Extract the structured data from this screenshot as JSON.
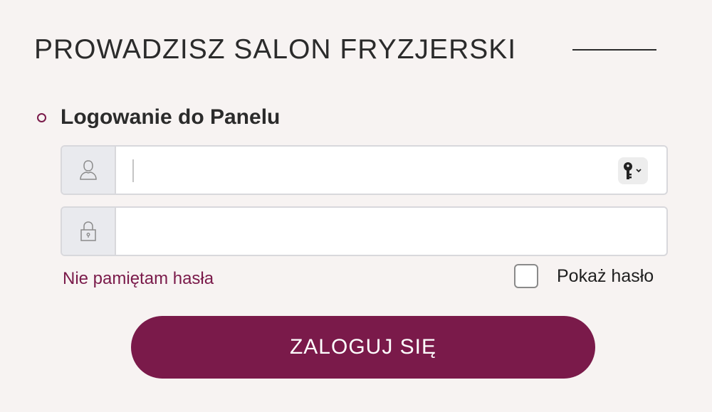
{
  "header": {
    "title": "PROWADZISZ SALON FRYZJERSKI"
  },
  "login_section": {
    "title": "Logowanie do Panelu"
  },
  "login_field": {
    "value": "",
    "placeholder": "",
    "icon": "user-icon",
    "autofill_icon": "key-icon"
  },
  "password_field": {
    "value": "",
    "placeholder": "",
    "icon": "lock-icon"
  },
  "links": {
    "forgot_password": "Nie pamiętam hasła"
  },
  "show_password": {
    "label": "Pokaż hasło",
    "checked": false
  },
  "submit": {
    "label": "ZALOGUJ SIĘ"
  },
  "colors": {
    "accent": "#7a1a4a",
    "background": "#f7f3f2"
  }
}
